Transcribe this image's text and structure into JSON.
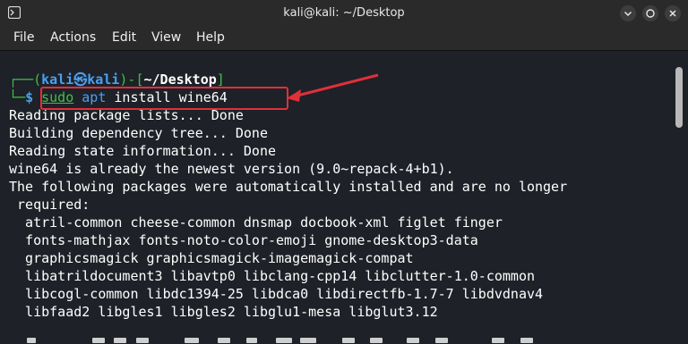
{
  "window": {
    "title": "kali@kali: ~/Desktop"
  },
  "menu": {
    "items": [
      "File",
      "Actions",
      "Edit",
      "View",
      "Help"
    ]
  },
  "prompt": {
    "user": "kali",
    "host": "kali",
    "symbol": "㉿",
    "path": "~/Desktop",
    "dollar": "$"
  },
  "command": {
    "sudo": "sudo",
    "apt": "apt",
    "rest": " install wine64"
  },
  "output_lines": [
    "Reading package lists... Done",
    "Building dependency tree... Done",
    "Reading state information... Done",
    "wine64 is already the newest version (9.0~repack-4+b1).",
    "The following packages were automatically installed and are no longer",
    " required:",
    "  atril-common cheese-common dnsmap docbook-xml figlet finger",
    "  fonts-mathjax fonts-noto-color-emoji gnome-desktop3-data",
    "  graphicsmagick graphicsmagick-imagemagick-compat",
    "  libatrildocument3 libavtp0 libclang-cpp14 libclutter-1.0-common",
    "  libcogl-common libdc1394-25 libdca0 libdirectfb-1.7-7 libdvdnav4",
    "  libfaad2 libgles1 libgles2 libglu1-mesa libglut3.12"
  ],
  "colors": {
    "prompt_green": "#3ec14b",
    "prompt_blue": "#4aa0f0",
    "highlight_red": "#e0303a",
    "terminal_bg": "#1e2127"
  }
}
